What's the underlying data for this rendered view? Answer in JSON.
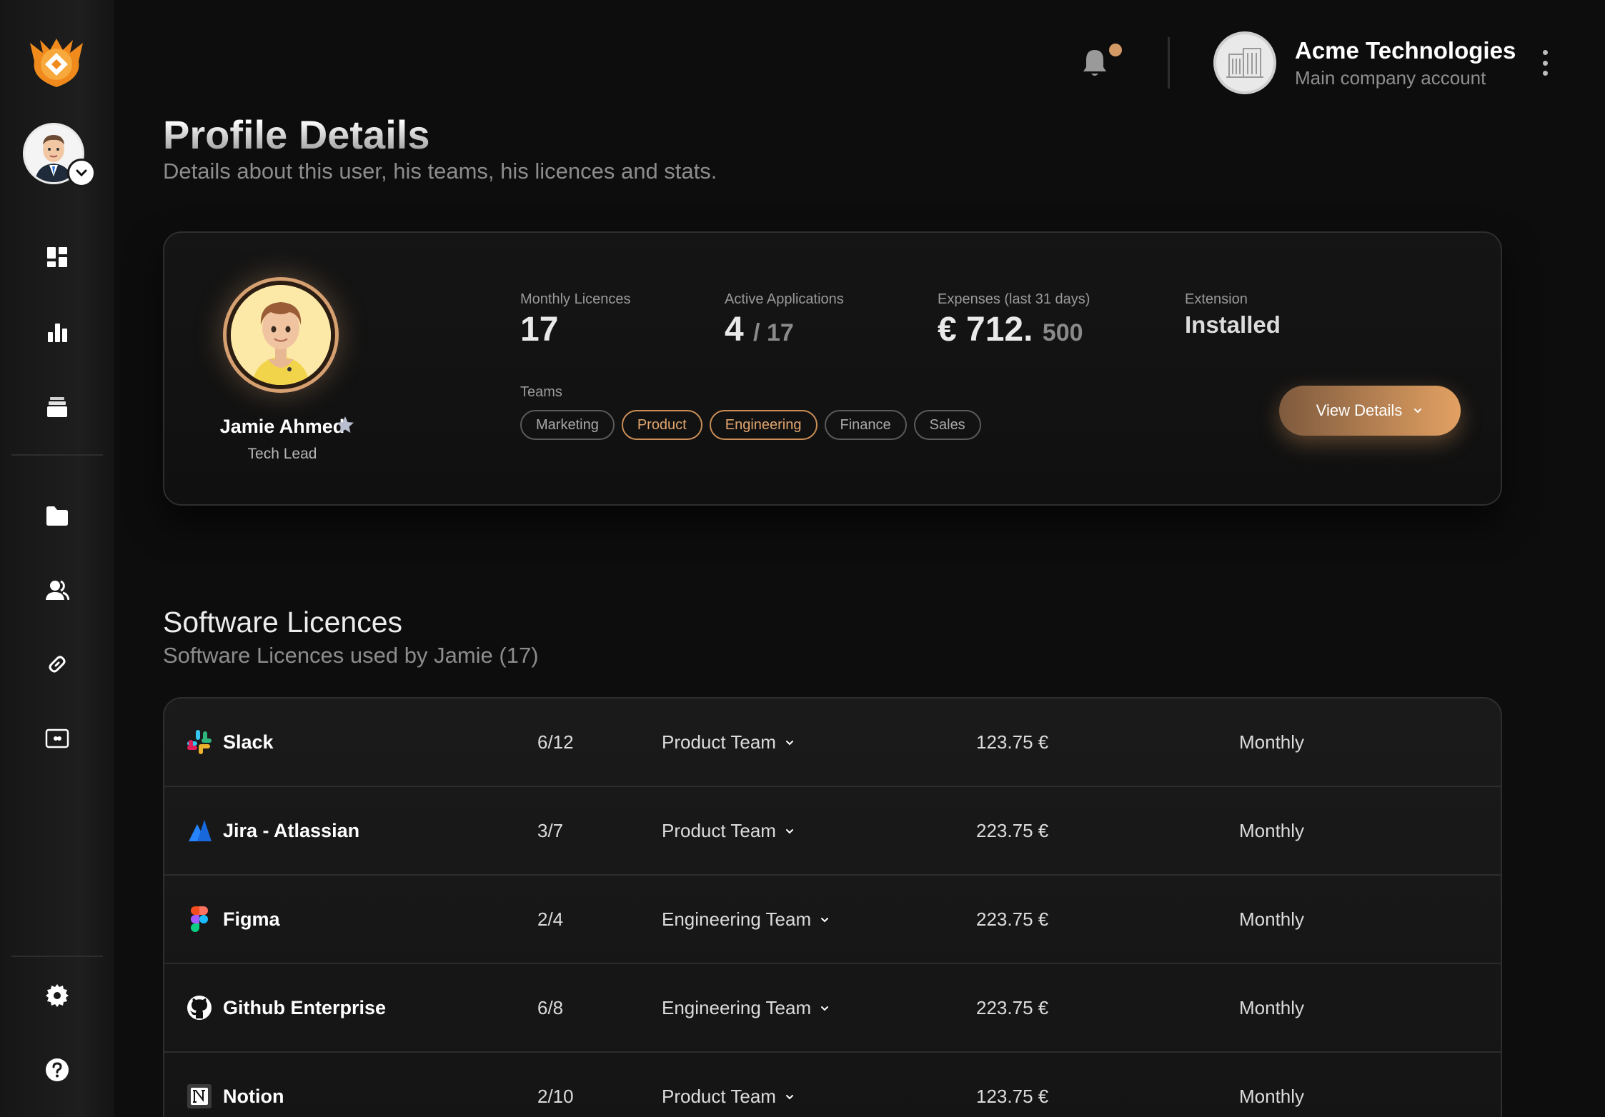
{
  "header": {
    "company_name": "Acme Technologies",
    "company_subtitle": "Main company account"
  },
  "page": {
    "title": "Profile Details",
    "subtitle": "Details about this user, his teams, his licences and stats."
  },
  "profile": {
    "name": "Jamie Ahmed",
    "role": "Tech Lead",
    "stats": {
      "monthly_licences_label": "Monthly Licences",
      "monthly_licences_value": "17",
      "active_apps_label": "Active Applications",
      "active_apps_value": "4",
      "active_apps_total": "/ 17",
      "expenses_label": "Expenses (last 31 days)",
      "expenses_value": "€ 712.",
      "expenses_decimals": "500",
      "extension_label": "Extension",
      "extension_value": "Installed"
    },
    "teams_label": "Teams",
    "teams": [
      {
        "label": "Marketing",
        "active": false
      },
      {
        "label": "Product",
        "active": true
      },
      {
        "label": "Engineering",
        "active": true
      },
      {
        "label": "Finance",
        "active": false
      },
      {
        "label": "Sales",
        "active": false
      }
    ],
    "view_details_label": "View Details"
  },
  "licences": {
    "title": "Software Licences",
    "subtitle": "Software Licences used by Jamie (17)",
    "rows": [
      {
        "name": "Slack",
        "seats": "6/12",
        "team": "Product Team",
        "price": "123.75 €",
        "billing": "Monthly",
        "icon": "slack-icon"
      },
      {
        "name": "Jira - Atlassian",
        "seats": "3/7",
        "team": "Product Team",
        "price": "223.75 €",
        "billing": "Monthly",
        "icon": "jira-icon"
      },
      {
        "name": "Figma",
        "seats": "2/4",
        "team": "Engineering Team",
        "price": "223.75 €",
        "billing": "Monthly",
        "icon": "figma-icon"
      },
      {
        "name": "Github Enterprise",
        "seats": "6/8",
        "team": "Engineering Team",
        "price": "223.75 €",
        "billing": "Monthly",
        "icon": "github-icon"
      },
      {
        "name": "Notion",
        "seats": "2/10",
        "team": "Product Team",
        "price": "123.75 €",
        "billing": "Monthly",
        "icon": "notion-icon"
      }
    ]
  },
  "colors": {
    "accent": "#d49a66",
    "background": "#0d0d0d",
    "card_border": "#2e2e2e"
  }
}
